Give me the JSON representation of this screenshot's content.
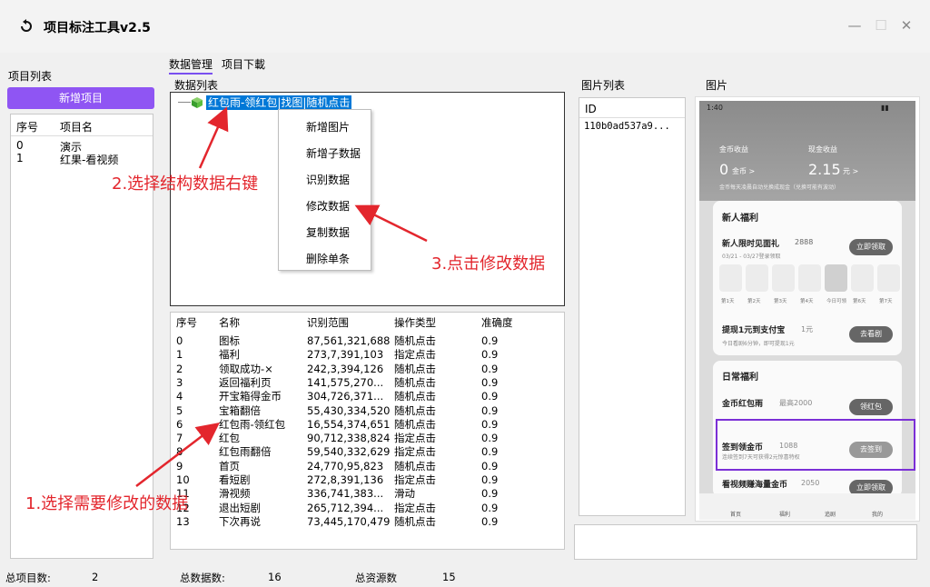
{
  "window": {
    "title": "项目标注工具v2.5",
    "controls": [
      "—",
      "☐",
      "✕"
    ]
  },
  "left": {
    "section_label": "项目列表",
    "new_button": "新增项目",
    "columns": [
      "序号",
      "项目名"
    ],
    "rows": [
      [
        "0",
        "演示"
      ],
      [
        "1",
        "红果-看视频"
      ]
    ]
  },
  "tabs": [
    "数据管理",
    "项目下載"
  ],
  "data_list_label": "数据列表",
  "tree": {
    "node": "红包雨-领红包|找图|随机点击"
  },
  "context_menu": [
    "新增图片",
    "新增子数据",
    "识别数据",
    "修改数据",
    "复制数据",
    "删除单条"
  ],
  "table": {
    "columns": [
      "序号",
      "名称",
      "识别范围",
      "操作类型",
      "准确度"
    ],
    "rows": [
      [
        "0",
        "图标",
        "87,561,321,688",
        "随机点击",
        "0.9"
      ],
      [
        "1",
        "福利",
        "273,7,391,103",
        "指定点击",
        "0.9"
      ],
      [
        "2",
        "领取成功-×",
        "242,3,394,126",
        "随机点击",
        "0.9"
      ],
      [
        "3",
        "返回福利页",
        "141,575,270...",
        "随机点击",
        "0.9"
      ],
      [
        "4",
        "开宝箱得金币",
        "304,726,371...",
        "随机点击",
        "0.9"
      ],
      [
        "5",
        "宝箱翻倍",
        "55,430,334,520",
        "随机点击",
        "0.9"
      ],
      [
        "6",
        "红包雨-领红包",
        "16,554,374,651",
        "随机点击",
        "0.9"
      ],
      [
        "7",
        "红包",
        "90,712,338,824",
        "指定点击",
        "0.9"
      ],
      [
        "8",
        "红包雨翻倍",
        "59,540,332,629",
        "指定点击",
        "0.9"
      ],
      [
        "9",
        "首页",
        "24,770,95,823",
        "随机点击",
        "0.9"
      ],
      [
        "10",
        "看短剧",
        "272,8,391,136",
        "指定点击",
        "0.9"
      ],
      [
        "11",
        "滑视频",
        "336,741,383...",
        "滑动",
        "0.9"
      ],
      [
        "12",
        "退出短剧",
        "265,712,394...",
        "指定点击",
        "0.9"
      ],
      [
        "13",
        "下次再说",
        "73,445,170,479",
        "随机点击",
        "0.9"
      ]
    ]
  },
  "image_list": {
    "label": "图片列表",
    "column": "ID",
    "rows": [
      "110b0ad537a9..."
    ]
  },
  "image_panel": {
    "label": "图片"
  },
  "phone": {
    "time": "1:40",
    "coin_label": "金币收益",
    "coin_value": "0",
    "coin_unit": "金币 >",
    "cash_label": "现金收益",
    "cash_value": "2.15",
    "cash_unit": "元 >",
    "note": "金币每天凌晨自动兑换成现金（兑换可能有波动）",
    "newbie_title": "新人福利",
    "limit_title": "新人限时见面礼",
    "limit_amount": "2888",
    "limit_button": "立即领取",
    "limit_date": "03/21 - 03/27登录领取",
    "days": [
      "第1天",
      "第2天",
      "第3天",
      "第4天",
      "今日可领",
      "第6天",
      "第7天"
    ],
    "withdraw_title": "提现1元到支付宝",
    "withdraw_amount": "1元",
    "withdraw_note": "今日看剧6分钟，即可提现1元",
    "withdraw_button": "去看剧",
    "daily_title": "日常福利",
    "redpack_title": "金币红包雨",
    "redpack_amount": "最高2000",
    "redpack_button": "领红包",
    "signin_title": "签到领金币",
    "signin_amount": "1088",
    "signin_note": "连续签到7天可获得2元惊喜特权",
    "signin_button": "去签到",
    "drama_title": "看视频赚海量金币",
    "drama_amount": "2050",
    "drama_button": "立即领取",
    "tabbar": [
      "首页",
      "福利",
      "追剧",
      "我的"
    ]
  },
  "annotations": {
    "step1": "1.选择需要修改的数据",
    "step2": "2.选择结构数据右键",
    "step3": "3.点击修改数据"
  },
  "status_bar": {
    "total_projects_label": "总项目数:",
    "total_projects": "2",
    "total_data_label": "总数据数:",
    "total_data": "16",
    "total_resources_label": "总资源数",
    "total_resources": "15"
  },
  "colors": {
    "accent": "#8f55f3",
    "highlight": "#0078d7",
    "annotation": "#e3262d",
    "selection_box": "#7b2fd6"
  }
}
